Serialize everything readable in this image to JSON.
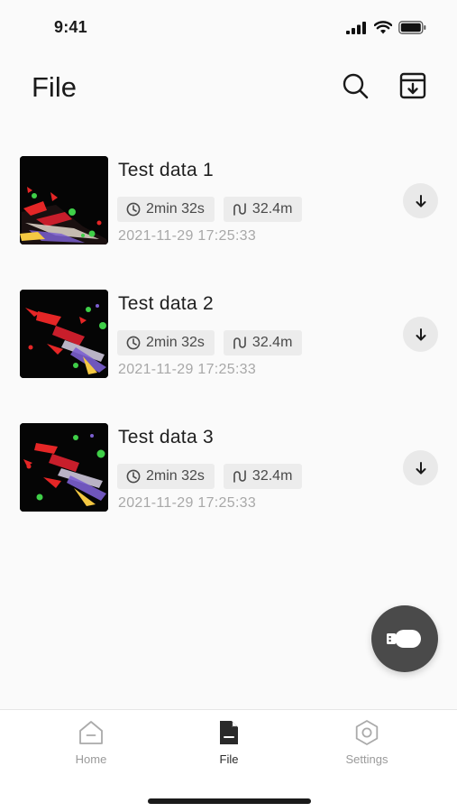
{
  "status_bar": {
    "time": "9:41"
  },
  "header": {
    "title": "File"
  },
  "files": [
    {
      "title": "Test data 1",
      "duration": "2min 32s",
      "distance": "32.4m",
      "date": "2021-11-29 17:25:33"
    },
    {
      "title": "Test data 2",
      "duration": "2min 32s",
      "distance": "32.4m",
      "date": "2021-11-29 17:25:33"
    },
    {
      "title": "Test data 3",
      "duration": "2min 32s",
      "distance": "32.4m",
      "date": "2021-11-29 17:25:33"
    }
  ],
  "icons": {
    "header": [
      "search-icon",
      "archive-download-icon"
    ],
    "tag": [
      "clock-icon",
      "path-icon"
    ],
    "item_action": "download-icon",
    "fab": "usb-drive-icon",
    "tabs": [
      "home-icon",
      "file-icon",
      "gear-icon"
    ]
  },
  "tab_bar": {
    "active": "File",
    "tabs": [
      {
        "label": "Home"
      },
      {
        "label": "File"
      },
      {
        "label": "Settings"
      }
    ]
  },
  "colors": {
    "background": "#fafafa",
    "tag_background": "#ececec",
    "fab": "#4a4a4a",
    "date_text": "#a8a8a8",
    "active_tab": "#2a2a2a",
    "inactive_tab": "#9a9a9a"
  }
}
